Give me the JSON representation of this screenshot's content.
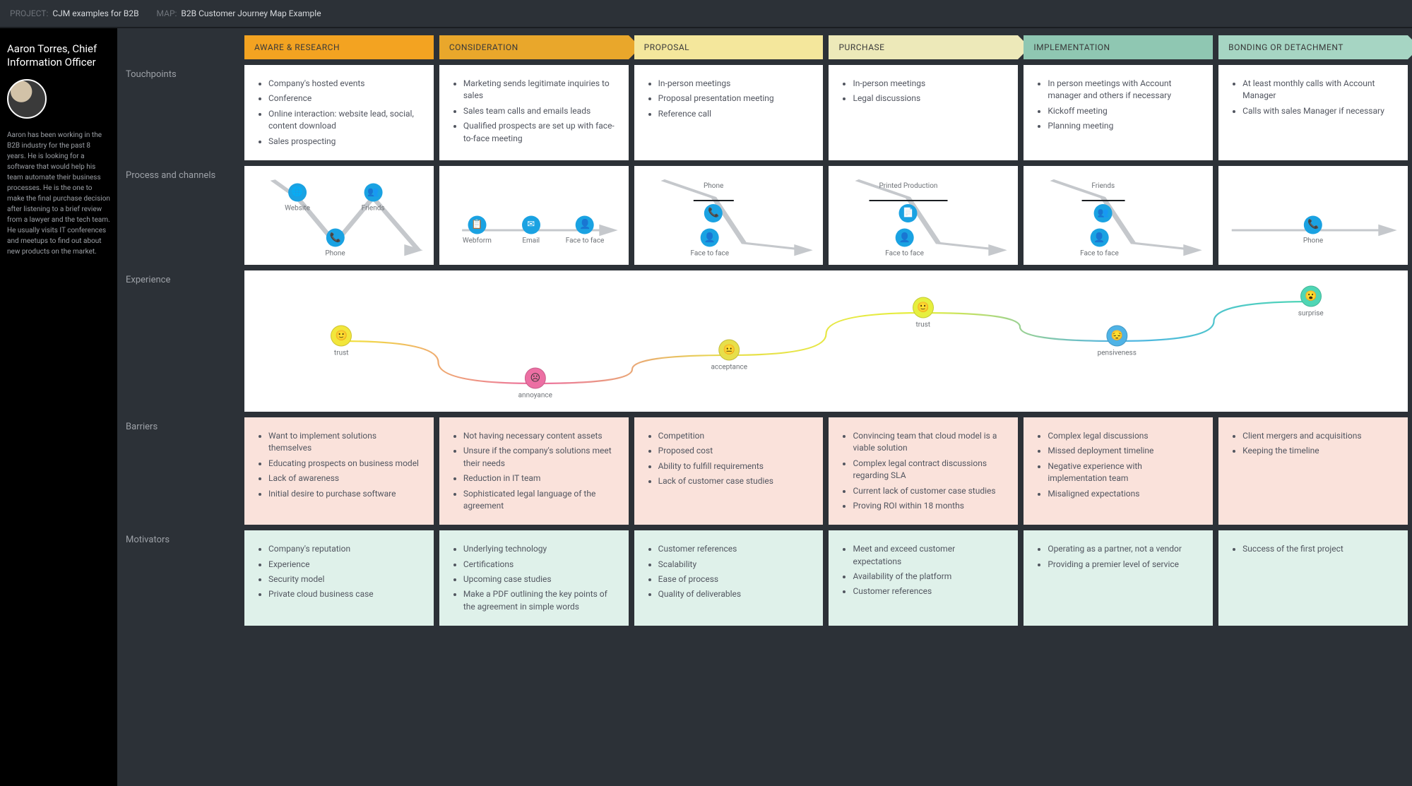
{
  "header": {
    "project_label": "PROJECT:",
    "project": "CJM examples for B2B",
    "map_label": "MAP:",
    "map": "B2B Customer Journey Map Example"
  },
  "persona": {
    "name": "Aaron Torres, Chief Information Officer",
    "bio": "Aaron has been working in the B2B industry for the past 8 years. He is looking for a software that would help his team automate their business processes. He is the one to make the final purchase decision after listening to a brief review from a lawyer and the tech team. He usually visits IT conferences and meetups to find out about new products on the market."
  },
  "row_labels": {
    "touchpoints": "Touchpoints",
    "process": "Process and channels",
    "experience": "Experience",
    "barriers": "Barriers",
    "motivators": "Motivators"
  },
  "stages": [
    {
      "id": "aware",
      "title": "AWARE & RESEARCH",
      "color": "c0"
    },
    {
      "id": "consider",
      "title": "CONSIDERATION",
      "color": "c1",
      "arrow": true
    },
    {
      "id": "proposal",
      "title": "PROPOSAL",
      "color": "c2"
    },
    {
      "id": "purchase",
      "title": "PURCHASE",
      "color": "c3",
      "arrow": true
    },
    {
      "id": "implement",
      "title": "IMPLEMENTATION",
      "color": "c4"
    },
    {
      "id": "bonding",
      "title": "BONDING OR DETACHMENT",
      "color": "c5",
      "arrow": true
    }
  ],
  "touchpoints": [
    [
      "Company's hosted events",
      "Conference",
      "Online interaction: website lead, social, content download",
      "Sales prospecting"
    ],
    [
      "Marketing sends legitimate inquiries to sales",
      "Sales team calls and emails leads",
      "Qualified prospects are set up with face-to-face meeting"
    ],
    [
      "In-person meetings",
      "Proposal presentation meeting",
      "Reference call"
    ],
    [
      "In-person meetings",
      "Legal discussions"
    ],
    [
      "In person meetings with Account manager and others if necessary",
      "Kickoff meeting",
      "Planning meeting"
    ],
    [
      "At least monthly calls with Account Manager",
      "Calls with sales Manager if necessary"
    ]
  ],
  "process_channels": [
    {
      "type": "zig",
      "top": [
        {
          "icon": "globe",
          "label": "Website"
        },
        {
          "icon": "users",
          "label": "Friends"
        }
      ],
      "bottom": [
        {
          "icon": "phone",
          "label": "Phone"
        }
      ]
    },
    {
      "type": "line",
      "items": [
        {
          "icon": "form",
          "label": "Webform"
        },
        {
          "icon": "mail",
          "label": "Email"
        },
        {
          "icon": "person",
          "label": "Face to face"
        }
      ]
    },
    {
      "type": "zig",
      "top": [
        {
          "icon": "phone",
          "label": "Phone"
        }
      ],
      "bottom": [
        {
          "icon": "person",
          "label": "Face to face"
        }
      ]
    },
    {
      "type": "zig",
      "top": [
        {
          "icon": "doc",
          "label": "Printed Production"
        }
      ],
      "bottom": [
        {
          "icon": "person",
          "label": "Face to face"
        }
      ]
    },
    {
      "type": "zig",
      "top": [
        {
          "icon": "users",
          "label": "Friends"
        }
      ],
      "bottom": [
        {
          "icon": "person",
          "label": "Face to face"
        }
      ]
    },
    {
      "type": "line",
      "items": [
        {
          "icon": "phone",
          "label": "Phone"
        }
      ]
    }
  ],
  "experience": [
    {
      "emotion": "trust",
      "y": 0.5,
      "color": "#f2e63b"
    },
    {
      "emotion": "annoyance",
      "y": 0.8,
      "color": "#ec6fa3"
    },
    {
      "emotion": "acceptance",
      "y": 0.6,
      "color": "#e7df4a"
    },
    {
      "emotion": "trust",
      "y": 0.3,
      "color": "#e6ef3f"
    },
    {
      "emotion": "pensiveness",
      "y": 0.5,
      "color": "#4fb3e6"
    },
    {
      "emotion": "surprise",
      "y": 0.22,
      "color": "#4fd6b4"
    }
  ],
  "barriers": [
    [
      "Want to implement solutions themselves",
      "Educating prospects on business model",
      "Lack of awareness",
      "Initial desire to purchase software"
    ],
    [
      "Not having necessary content assets",
      "Unsure if the company's solutions meet their needs",
      "Reduction in IT team",
      "Sophisticated legal language of the agreement"
    ],
    [
      "Competition",
      "Proposed cost",
      "Ability to fulfill requirements",
      "Lack of customer case studies"
    ],
    [
      "Convincing team that cloud model is a viable solution",
      "Complex legal contract discussions regarding SLA",
      "Current lack of customer case studies",
      "Proving ROI within 18 months"
    ],
    [
      "Complex legal discussions",
      "Missed deployment timeline",
      "Negative experience with implementation team",
      "Misaligned expectations"
    ],
    [
      "Client mergers and acquisitions",
      "Keeping the timeline"
    ]
  ],
  "motivators": [
    [
      "Company's reputation",
      "Experience",
      "Security model",
      "Private cloud business case"
    ],
    [
      "Underlying technology",
      "Certifications",
      "Upcoming case studies",
      "Make a PDF outlining the key points of the agreement in simple words"
    ],
    [
      "Customer references",
      "Scalability",
      "Ease of process",
      "Quality of deliverables"
    ],
    [
      "Meet and exceed customer expectations",
      "Availability of the platform",
      "Customer references"
    ],
    [
      "Operating as a partner, not a vendor",
      "Providing a premier level of service"
    ],
    [
      "Success of the first project"
    ]
  ],
  "icons": {
    "globe": "🌐",
    "users": "👥",
    "phone": "📞",
    "form": "📋",
    "mail": "✉",
    "person": "👤",
    "doc": "📄"
  }
}
